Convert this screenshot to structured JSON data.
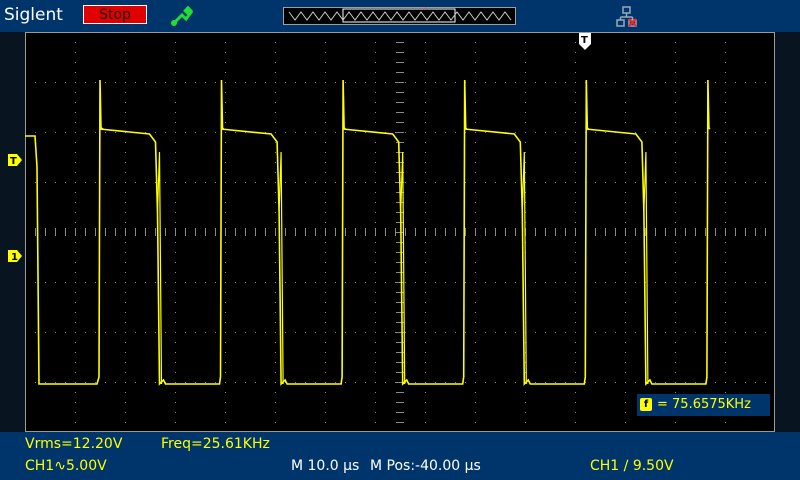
{
  "header": {
    "brand": "Siglent",
    "run_state": "Stop",
    "icons": [
      "usb-icon",
      "waveform-overview",
      "network-disconnected-icon"
    ],
    "trigger_position_label": "T"
  },
  "display": {
    "channel1_marker": "1",
    "trigger_level_marker": "T",
    "frequency_counter": "= 75.6575KHz",
    "frequency_counter_icon": "f",
    "trace_color": "#ffff00"
  },
  "measurements": {
    "vrms": "Vrms=12.20V",
    "freq": "Freq=25.61KHz"
  },
  "status_bar": {
    "ch1_scale": "CH1∿5.00V",
    "timebase": "M 10.0 µs",
    "horizontal_position": "M Pos:-40.00 µs",
    "trigger": "CH1 ∕ 9.50V"
  },
  "colors": {
    "topbar": "#00356b",
    "screen": "#000000",
    "trace": "#ffff00",
    "stop": "#e00000"
  }
}
